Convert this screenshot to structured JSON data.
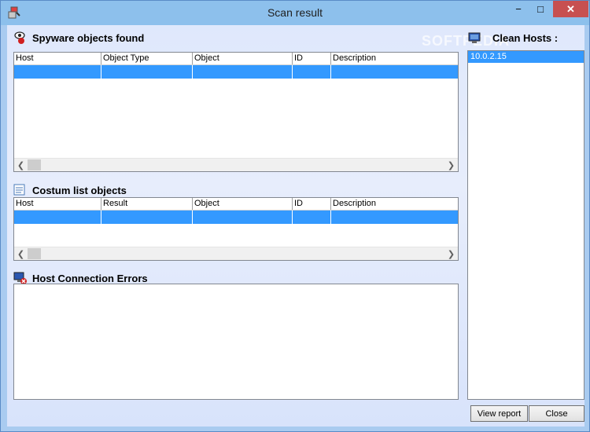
{
  "window": {
    "title": "Scan result",
    "controls": {
      "minimize": "−",
      "maximize": "□",
      "close": "✕"
    },
    "watermark": "SOFTPEDIA"
  },
  "spyware": {
    "title": "Spyware objects found",
    "columns": [
      "Host",
      "Object Type",
      "Object",
      "ID",
      "Description"
    ],
    "icon": "spyware-eye-icon"
  },
  "custom": {
    "title": "Costum list objects",
    "columns": [
      "Host",
      "Result",
      "Object",
      "ID",
      "Description"
    ],
    "icon": "list-icon"
  },
  "errors": {
    "title": "Host Connection Errors",
    "icon": "host-error-icon"
  },
  "hosts": {
    "title": "Clean Hosts :",
    "items": [
      "10.0.2.15"
    ],
    "icon": "monitor-icon"
  },
  "buttons": {
    "view_report": "View report",
    "close": "Close"
  },
  "colors": {
    "selection": "#3399ff",
    "titlebar": "#8dc0ec",
    "close_button": "#c75050"
  }
}
